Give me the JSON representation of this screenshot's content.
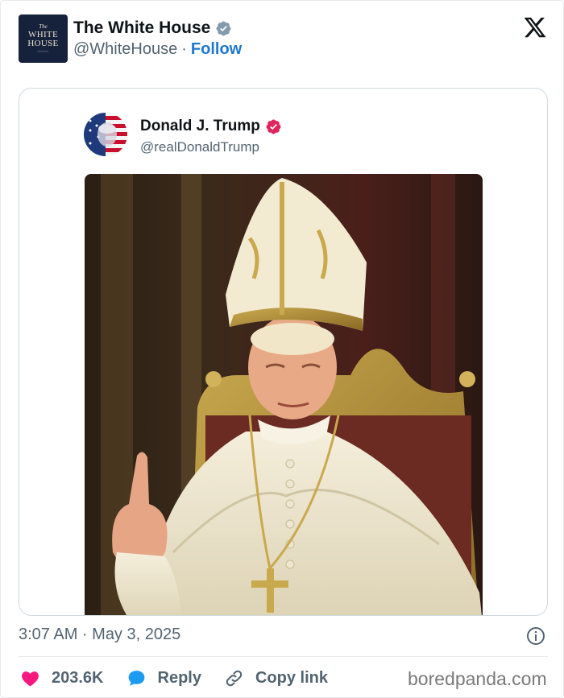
{
  "author": {
    "display_name": "The White House",
    "handle": "@WhiteHouse",
    "separator": "·",
    "follow_label": "Follow",
    "avatar_text": {
      "the": "The",
      "line1": "WHITE",
      "line2": "HOUSE"
    },
    "verified_color": "#829aab"
  },
  "platform_icon": "x-logo-icon",
  "quoted_post": {
    "display_name": "Donald J. Trump",
    "handle": "@realDonaldTrump",
    "verified_color": "#e0245e",
    "image_description_icon": "image"
  },
  "meta": {
    "timestamp": "3:07 AM · May 3, 2025"
  },
  "actions": {
    "like_count": "203.6K",
    "reply_label": "Reply",
    "copy_label": "Copy link"
  },
  "watermark": "boredpanda.com",
  "colors": {
    "like": "#f91880",
    "reply": "#1d9bf0",
    "link_blue": "#1d78d2",
    "muted": "#536471"
  }
}
